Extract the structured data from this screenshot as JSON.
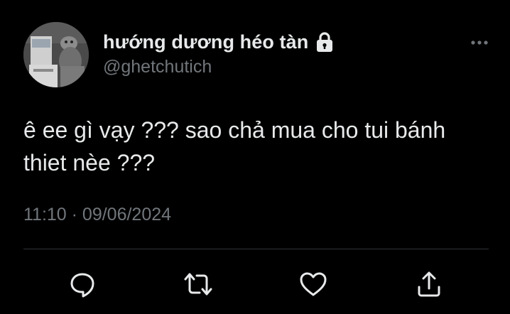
{
  "tweet": {
    "display_name": "hướng dương héo tàn",
    "handle": "@ghetchutich",
    "text": "ê ee gì vạy ??? sao chả mua cho tui bánh\nthiet nèe ???",
    "timestamp": "11:10 · 09/06/2024"
  },
  "icons": {
    "lock": "lock-icon",
    "more": "more-icon",
    "reply": "reply-icon",
    "retweet": "retweet-icon",
    "like": "heart-icon",
    "share": "share-icon"
  },
  "colors": {
    "background": "#000000",
    "primary_text": "#e7e9ea",
    "secondary_text": "#71767b",
    "divider": "#2f3336"
  }
}
